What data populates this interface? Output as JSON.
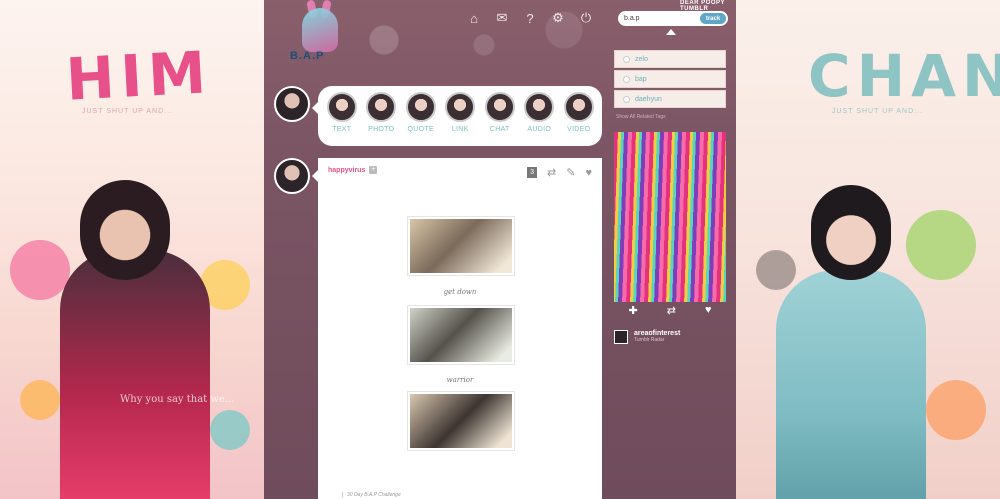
{
  "side_left": {
    "word": "HIM",
    "subtext": "JUST SHUT UP AND...",
    "quote": "Why you say that we..."
  },
  "side_right": {
    "word": "CHAN",
    "subtext": "JUST SHUT UP AND..."
  },
  "header": {
    "logo_text": "B.A.P",
    "credit": "DEAR POOPY TUMBLR",
    "nav_icons": [
      "home-icon",
      "mail-icon",
      "help-icon",
      "gear-icon",
      "power-icon"
    ]
  },
  "search": {
    "value": "b.a.p",
    "track_label": "track"
  },
  "composer": {
    "types": [
      {
        "label": "TEXT"
      },
      {
        "label": "PHOTO"
      },
      {
        "label": "QUOTE"
      },
      {
        "label": "LINK"
      },
      {
        "label": "CHAT"
      },
      {
        "label": "AUDIO"
      },
      {
        "label": "VIDEO"
      }
    ]
  },
  "post": {
    "username": "happyvirus",
    "plus": "+",
    "note_count": "3",
    "captions": [
      "get down",
      "warrior"
    ],
    "footer": "30 Day B.A.P Challenge"
  },
  "tags": {
    "items": [
      "zelo",
      "bap",
      "daehyun"
    ],
    "show_all": "Show All Related Tags"
  },
  "radar": {
    "username": "areaofinterest",
    "subtitle": "Tumblr Radar"
  },
  "colors": {
    "panel": "#7b5564",
    "accent_pink": "#e8508a",
    "accent_teal": "#7ac2c7",
    "track_blue": "#5fa6c7"
  }
}
